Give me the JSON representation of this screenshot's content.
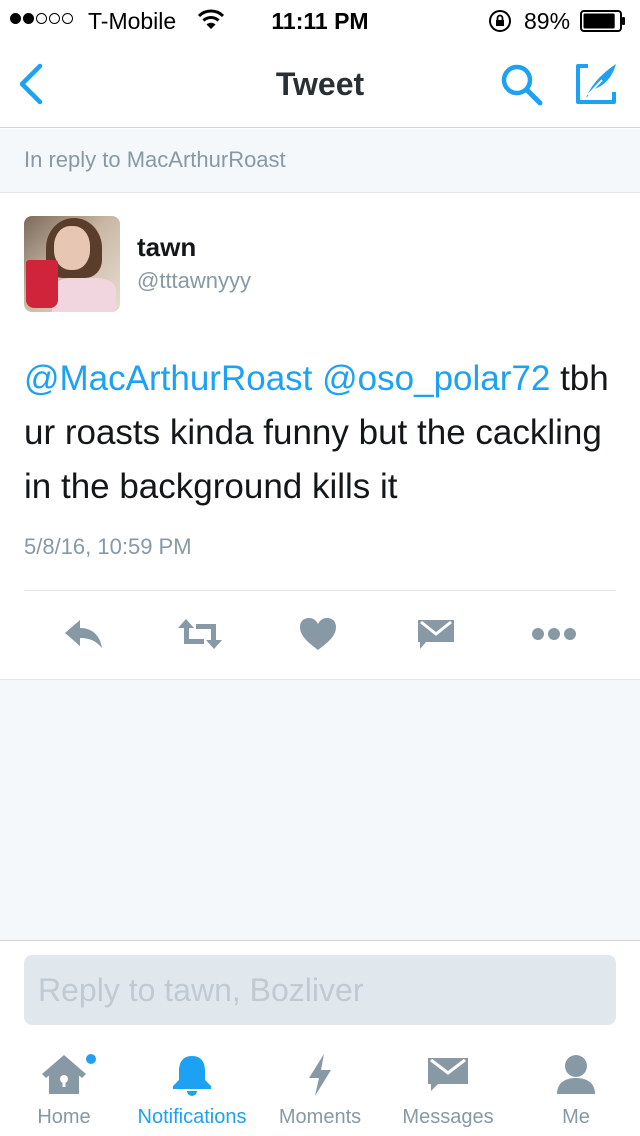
{
  "status_bar": {
    "carrier": "T-Mobile",
    "time": "11:11 PM",
    "battery_percent": "89%",
    "signal_bars_filled": 2,
    "signal_bars_total": 5,
    "battery_level": 0.89
  },
  "nav": {
    "title": "Tweet",
    "back_icon": "chevron-left-icon",
    "search_icon": "search-icon",
    "compose_icon": "compose-icon"
  },
  "reply_banner": {
    "text": "In reply to MacArthurRoast"
  },
  "tweet": {
    "display_name": "tawn",
    "handle": "@tttawnyyy",
    "mention_1": "@MacArthurRoast",
    "mention_2": "@oso_polar72",
    "body_text": "tbh ur roasts kinda funny but the cackling in the background kills it",
    "timestamp": "5/8/16, 10:59 PM",
    "actions": [
      "reply-icon",
      "retweet-icon",
      "like-icon",
      "direct-message-icon",
      "more-icon"
    ]
  },
  "reply_composer": {
    "placeholder": "Reply to tawn, Bozliver"
  },
  "tab_bar": {
    "home": "Home",
    "notifications": "Notifications",
    "moments": "Moments",
    "messages": "Messages",
    "me": "Me"
  },
  "colors": {
    "accent": "#1da1f2",
    "icon_gray": "#8899a6",
    "text": "#14171a",
    "background_gray": "#f5f8fa"
  }
}
